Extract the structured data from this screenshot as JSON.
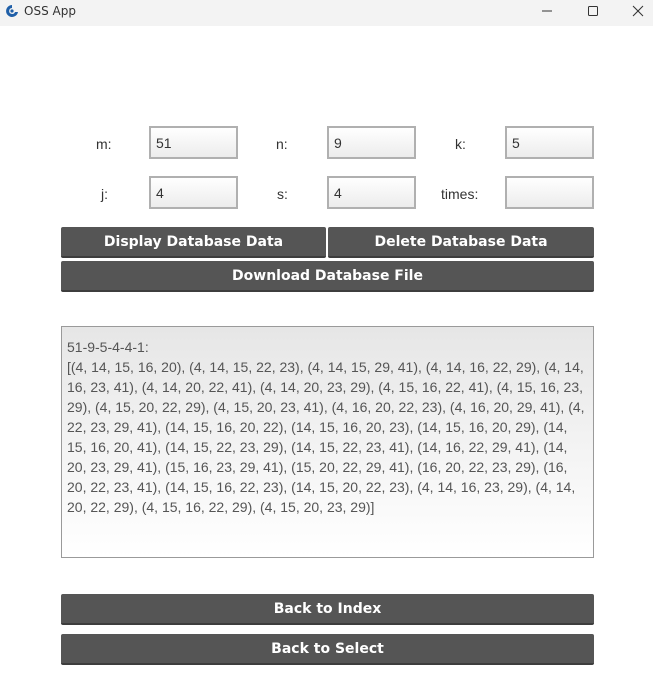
{
  "window": {
    "title": "OSS App",
    "icon": "app-logo-icon"
  },
  "form": {
    "m_label": "m:",
    "m_value": "51",
    "n_label": "n:",
    "n_value": "9",
    "k_label": "k:",
    "k_value": "5",
    "j_label": "j:",
    "j_value": "4",
    "s_label": "s:",
    "s_value": "4",
    "times_label": "times:",
    "times_value": ""
  },
  "buttons": {
    "display_db": "Display Database Data",
    "delete_db": "Delete Database Data",
    "download_db": "Download Database File",
    "back_index": "Back to Index",
    "back_select": "Back to Select"
  },
  "output": {
    "header": "51-9-5-4-4-1:",
    "text": "[(4, 14, 15, 16, 20), (4, 14, 15, 22, 23), (4, 14, 15, 29, 41), (4, 14, 16, 22, 29), (4, 14, 16, 23, 41), (4, 14, 20, 22, 41), (4, 14, 20, 23, 29), (4, 15, 16, 22, 41), (4, 15, 16, 23, 29), (4, 15, 20, 22, 29), (4, 15, 20, 23, 41), (4, 16, 20, 22, 23), (4, 16, 20, 29, 41), (4, 22, 23, 29, 41), (14, 15, 16, 20, 22), (14, 15, 16, 20, 23), (14, 15, 16, 20, 29), (14, 15, 16, 20, 41), (14, 15, 22, 23, 29), (14, 15, 22, 23, 41), (14, 16, 22, 29, 41), (14, 20, 23, 29, 41), (15, 16, 23, 29, 41), (15, 20, 22, 29, 41), (16, 20, 22, 23, 29), (16, 20, 22, 23, 41), (14, 15, 16, 22, 23), (14, 15, 20, 22, 23), (4, 14, 16, 23, 29), (4, 14, 20, 22, 29), (4, 15, 16, 22, 29), (4, 15, 20, 23, 29)]"
  },
  "colors": {
    "button_bg": "#555555",
    "button_text": "#ffffff",
    "titlebar_bg": "#f3f3f3"
  }
}
